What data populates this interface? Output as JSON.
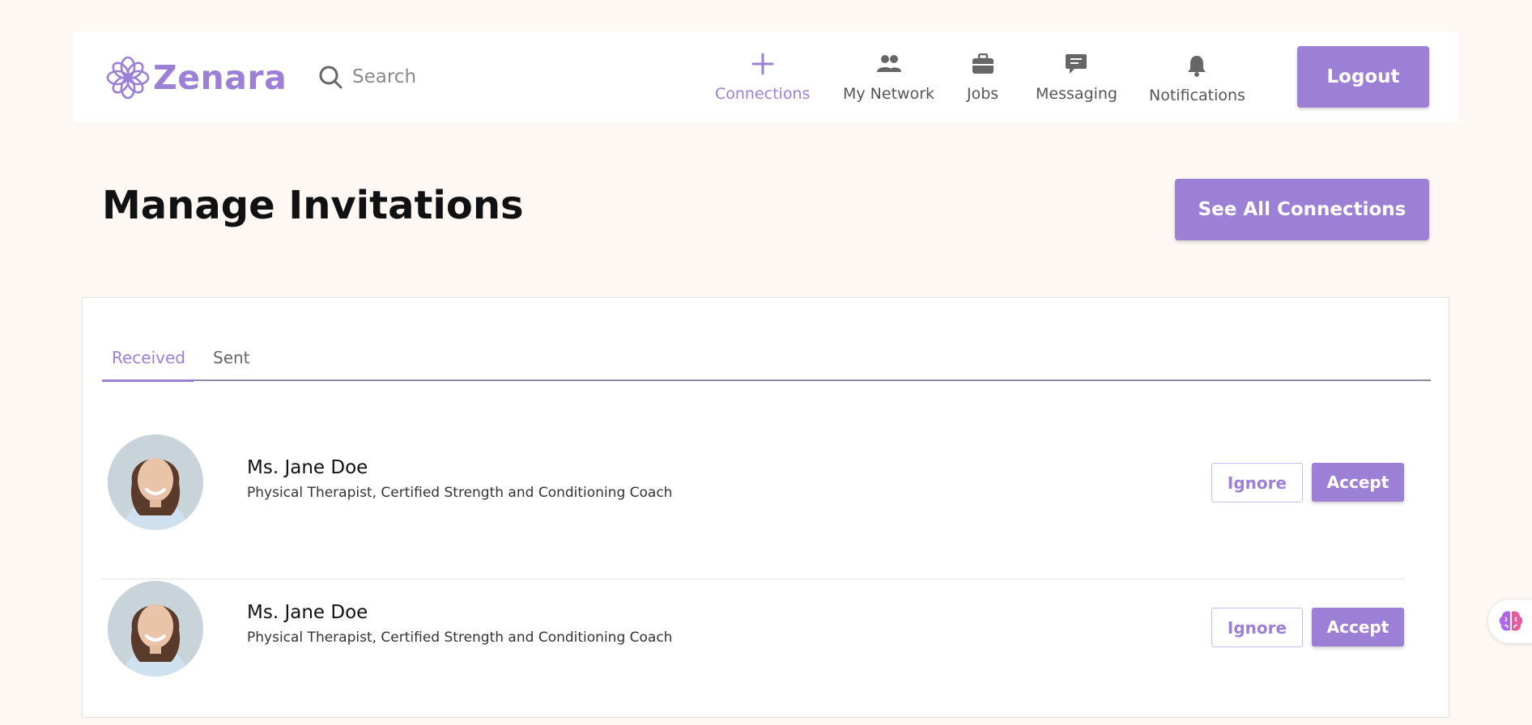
{
  "brand": {
    "name": "Zenara",
    "color": "#9b80d6"
  },
  "search": {
    "placeholder": "Search",
    "value": ""
  },
  "nav": [
    {
      "label": "Connections",
      "icon": "plus-icon",
      "active": true
    },
    {
      "label": "My Network",
      "icon": "people-icon",
      "active": false
    },
    {
      "label": "Jobs",
      "icon": "briefcase-icon",
      "active": false
    },
    {
      "label": "Messaging",
      "icon": "chat-bubble-icon",
      "active": false
    },
    {
      "label": "Notifications",
      "icon": "bell-icon",
      "active": false
    }
  ],
  "header": {
    "logout_label": "Logout"
  },
  "page": {
    "title": "Manage Invitations",
    "see_all_label": "See All Connections"
  },
  "tabs": [
    {
      "label": "Received",
      "active": true
    },
    {
      "label": "Sent",
      "active": false
    }
  ],
  "invitations": [
    {
      "name": "Ms. Jane Doe",
      "title": "Physical Therapist, Certified Strength and Conditioning Coach",
      "ignore_label": "Ignore",
      "accept_label": "Accept"
    },
    {
      "name": "Ms. Jane Doe",
      "title": "Physical Therapist, Certified Strength and Conditioning Coach",
      "ignore_label": "Ignore",
      "accept_label": "Accept"
    }
  ],
  "floating_widget": {
    "icon": "brain-icon"
  }
}
